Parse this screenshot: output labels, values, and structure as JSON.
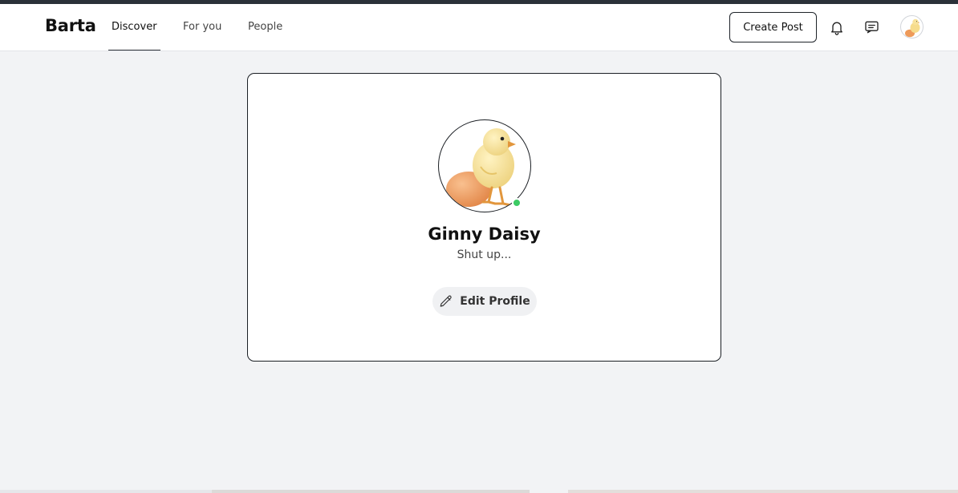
{
  "brand": {
    "name": "Barta"
  },
  "nav": {
    "links": [
      {
        "label": "Discover",
        "active": true
      },
      {
        "label": "For you",
        "active": false
      },
      {
        "label": "People",
        "active": false
      }
    ],
    "create_post_label": "Create Post",
    "icons": [
      "bell-icon",
      "message-icon",
      "user-avatar"
    ]
  },
  "profile": {
    "name": "Ginny Daisy",
    "bio": "Shut up...",
    "online": true,
    "edit_label": "Edit Profile"
  },
  "colors": {
    "background": "#f2f3f5",
    "online": "#3ccb64",
    "border": "#1b1f24"
  }
}
